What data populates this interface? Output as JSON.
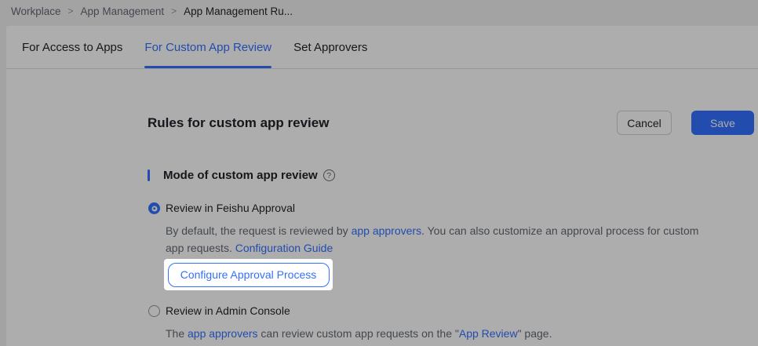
{
  "breadcrumb": {
    "separator": ">",
    "items": [
      "Workplace",
      "App Management",
      "App Management Ru..."
    ]
  },
  "tabs": [
    {
      "label": "For Access to Apps",
      "active": false
    },
    {
      "label": "For Custom App Review",
      "active": true
    },
    {
      "label": "Set Approvers",
      "active": false
    }
  ],
  "header": {
    "title": "Rules for custom app review",
    "cancel_label": "Cancel",
    "save_label": "Save"
  },
  "section": {
    "title": "Mode of custom app review",
    "help_icon": "?"
  },
  "option_feishu": {
    "label": "Review in Feishu Approval",
    "selected": true,
    "desc_t1": "By default, the request is reviewed by ",
    "desc_link1": "app approvers",
    "desc_t2": ". You can also customize an approval process for custom",
    "desc_t3": "app requests. ",
    "desc_link2": "Configuration Guide",
    "button_label": "Configure Approval Process"
  },
  "option_admin": {
    "label": "Review in Admin Console",
    "selected": false,
    "desc_t1": "The ",
    "desc_link1": "app approvers",
    "desc_t2": " can review custom app requests on the \"",
    "desc_link2": "App Review",
    "desc_t3": "\" page."
  },
  "colors": {
    "accent": "#3370ff",
    "text_primary": "#1f2329",
    "text_secondary": "#646a73",
    "divider": "#dee0e3",
    "overlay": "rgba(0,0,0,0.32)",
    "highlight_box": "#ffffff"
  }
}
